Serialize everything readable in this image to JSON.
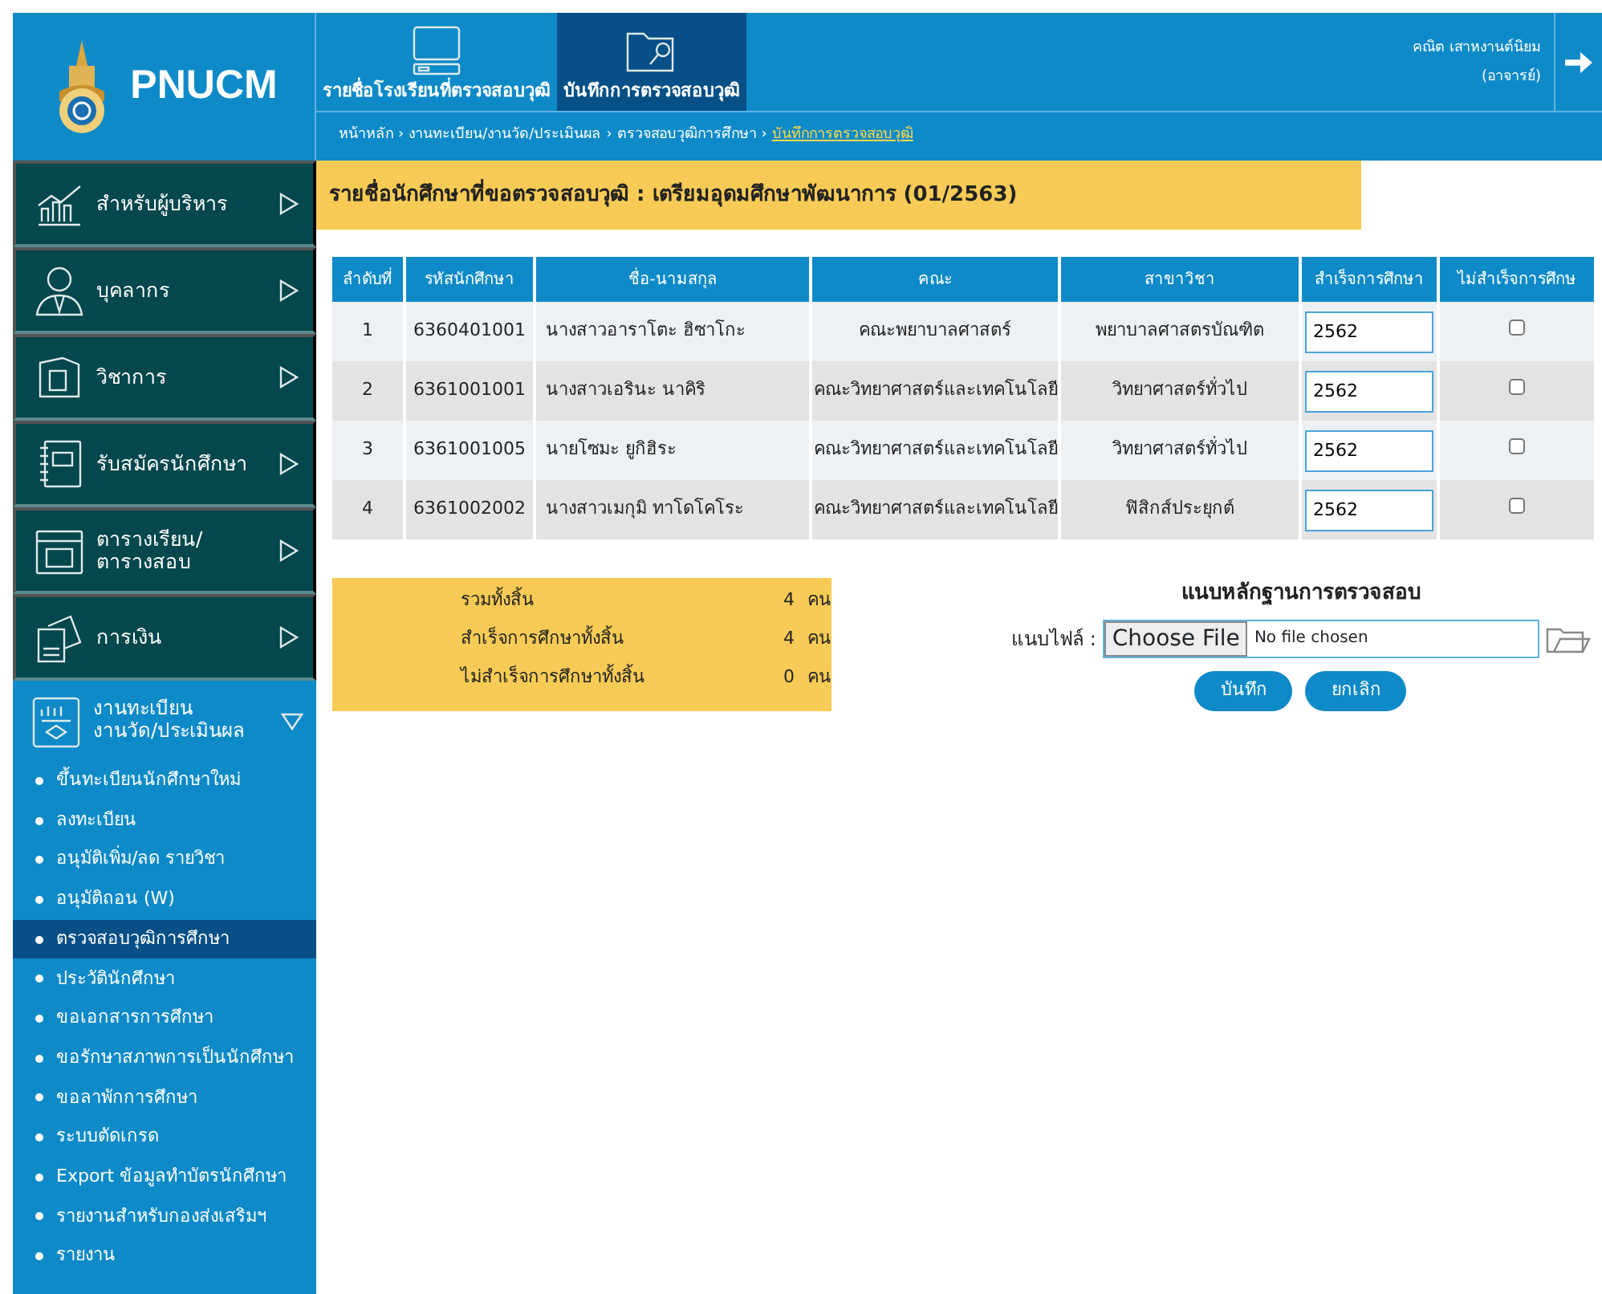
{
  "header": {
    "logo_text": "PNUCM",
    "tabs": [
      {
        "label": "รายชื่อโรงเรียนที่ตรวจสอบวุฒิ",
        "selected": false
      },
      {
        "label": "บันทึกการตรวจสอบวุฒิ",
        "selected": true
      }
    ],
    "user": {
      "name": "คณิต เสาหงานต์นิยม",
      "role": "(อาจารย์)"
    },
    "breadcrumb_separator": "›",
    "breadcrumb": [
      {
        "label": "หน้าหลัก",
        "current": false
      },
      {
        "label": "งานทะเบียน/งานวัด/ประเมินผล",
        "current": false
      },
      {
        "label": "ตรวจสอบวุฒิการศึกษา",
        "current": false
      },
      {
        "label": "บันทึกการตรวจสอบวุฒิ",
        "current": true
      }
    ]
  },
  "sidebar": {
    "menus": [
      {
        "label": "สำหรับผู้บริหาร",
        "expanded": false
      },
      {
        "label": "บุคลากร",
        "expanded": false
      },
      {
        "label": "วิชาการ",
        "expanded": false
      },
      {
        "label": "รับสมัครนักศึกษา",
        "expanded": false
      },
      {
        "label": "ตารางเรียน/\nตารางสอบ",
        "expanded": false
      },
      {
        "label": "การเงิน",
        "expanded": false
      },
      {
        "label": "งานทะเบียน\nงานวัด/ประเมินผล",
        "expanded": true,
        "children": [
          {
            "label": "ขึ้นทะเบียนนักศึกษาใหม่",
            "selected": false
          },
          {
            "label": "ลงทะเบียน",
            "selected": false
          },
          {
            "label": "อนุมัติเพิ่ม/ลด รายวิชา",
            "selected": false
          },
          {
            "label": "อนุมัติถอน (W)",
            "selected": false
          },
          {
            "label": "ตรวจสอบวุฒิการศึกษา",
            "selected": true
          },
          {
            "label": "ประวัตินักศึกษา",
            "selected": false
          },
          {
            "label": "ขอเอกสารการศึกษา",
            "selected": false
          },
          {
            "label": "ขอรักษาสภาพการเป็นนักศึกษา",
            "selected": false
          },
          {
            "label": "ขอลาพักการศึกษา",
            "selected": false
          },
          {
            "label": "ระบบตัดเกรด",
            "selected": false
          },
          {
            "label": "Export ข้อมูลทำบัตรนักศึกษา",
            "selected": false
          },
          {
            "label": "รายงานสำหรับกองส่งเสริมฯ",
            "selected": false
          },
          {
            "label": "รายงาน",
            "selected": false
          }
        ]
      }
    ]
  },
  "page_title": "รายชื่อนักศึกษาที่ขอตรวจสอบวุฒิ : เตรียมอุดมศึกษาพัฒนาการ (01/2563)",
  "table": {
    "columns": [
      "ลำดับที่",
      "รหัสนักศึกษา",
      "ชื่อ-นามสกุล",
      "คณะ",
      "สาขาวิชา",
      "สำเร็จการศึกษา",
      "ไม่สำเร็จการศึกษ"
    ],
    "rows": [
      {
        "no": "1",
        "student_id": "6360401001",
        "name": "นางสาวอาราโตะ ฮิซาโกะ",
        "faculty": "คณะพยาบาลศาสตร์",
        "major": "พยาบาลศาสตรบัณฑิต",
        "graduated_year": "2562",
        "not_graduated": false
      },
      {
        "no": "2",
        "student_id": "6361001001",
        "name": "นางสาวเอรินะ นาคิริ",
        "faculty": "คณะวิทยาศาสตร์และเทคโนโลยี",
        "major": "วิทยาศาสตร์ทั่วไป",
        "graduated_year": "2562",
        "not_graduated": false
      },
      {
        "no": "3",
        "student_id": "6361001005",
        "name": "นายโซมะ ยูกิฮิระ",
        "faculty": "คณะวิทยาศาสตร์และเทคโนโลยี",
        "major": "วิทยาศาสตร์ทั่วไป",
        "graduated_year": "2562",
        "not_graduated": false
      },
      {
        "no": "4",
        "student_id": "6361002002",
        "name": "นางสาวเมกุมิ ทาโดโคโระ",
        "faculty": "คณะวิทยาศาสตร์และเทคโนโลยี",
        "major": "ฟิสิกส์ประยุกต์",
        "graduated_year": "2562",
        "not_graduated": false
      }
    ]
  },
  "summary": [
    {
      "label": "รวมทั้งสิ้น",
      "count": "4",
      "unit": "คน"
    },
    {
      "label": "สำเร็จการศึกษาทั้งสิ้น",
      "count": "4",
      "unit": "คน"
    },
    {
      "label": "ไม่สำเร็จการศึกษาทั้งสิ้น",
      "count": "0",
      "unit": "คน"
    }
  ],
  "attachment": {
    "title": "แนบหลักฐานการตรวจสอบ",
    "field_label": "แนบไฟล์ :",
    "choose_button": "Choose File",
    "file_status": "No file chosen"
  },
  "buttons": [
    "บันทึก",
    "ยกเลิก"
  ]
}
